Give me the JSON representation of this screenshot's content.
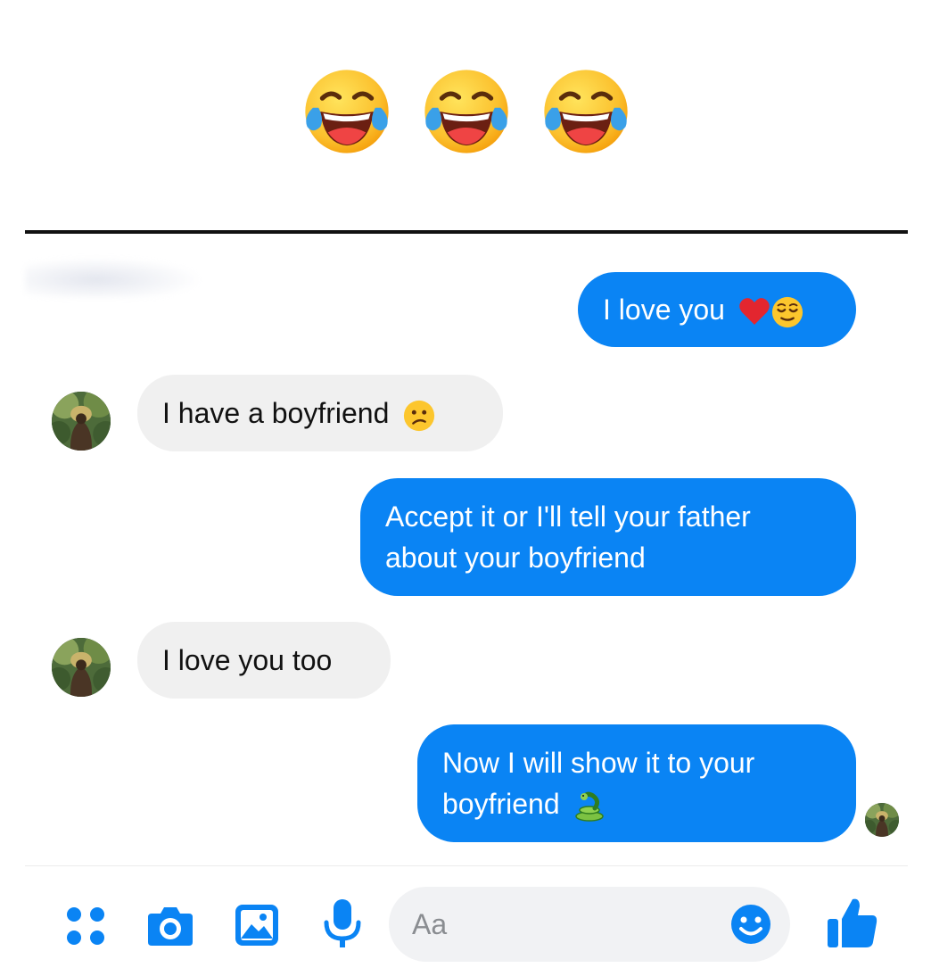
{
  "header": {
    "laugh_emojis": [
      "face-with-tears-of-joy",
      "face-with-tears-of-joy",
      "face-with-tears-of-joy"
    ]
  },
  "conversation": {
    "messages": [
      {
        "sender": "me",
        "text": "I love you",
        "emojis": [
          "red-heart",
          "relieved-face"
        ]
      },
      {
        "sender": "them",
        "text": "I have a boyfriend",
        "emojis": [
          "confused-face"
        ]
      },
      {
        "sender": "me",
        "lines": [
          "Accept it or I'll tell your father",
          "about your boyfriend"
        ]
      },
      {
        "sender": "them",
        "text": "I love you too"
      },
      {
        "sender": "me",
        "lines": [
          "Now I will show it to your",
          "boyfriend"
        ],
        "emojis": [
          "snake"
        ]
      }
    ]
  },
  "composer": {
    "placeholder": "Aa",
    "icons": [
      "apps-icon",
      "camera-icon",
      "gallery-icon",
      "microphone-icon",
      "emoji-icon",
      "thumbs-up-icon"
    ]
  },
  "colors": {
    "sent_bubble": "#0a84f4",
    "received_bubble": "#f0f0f0",
    "accent": "#0a84f4"
  }
}
